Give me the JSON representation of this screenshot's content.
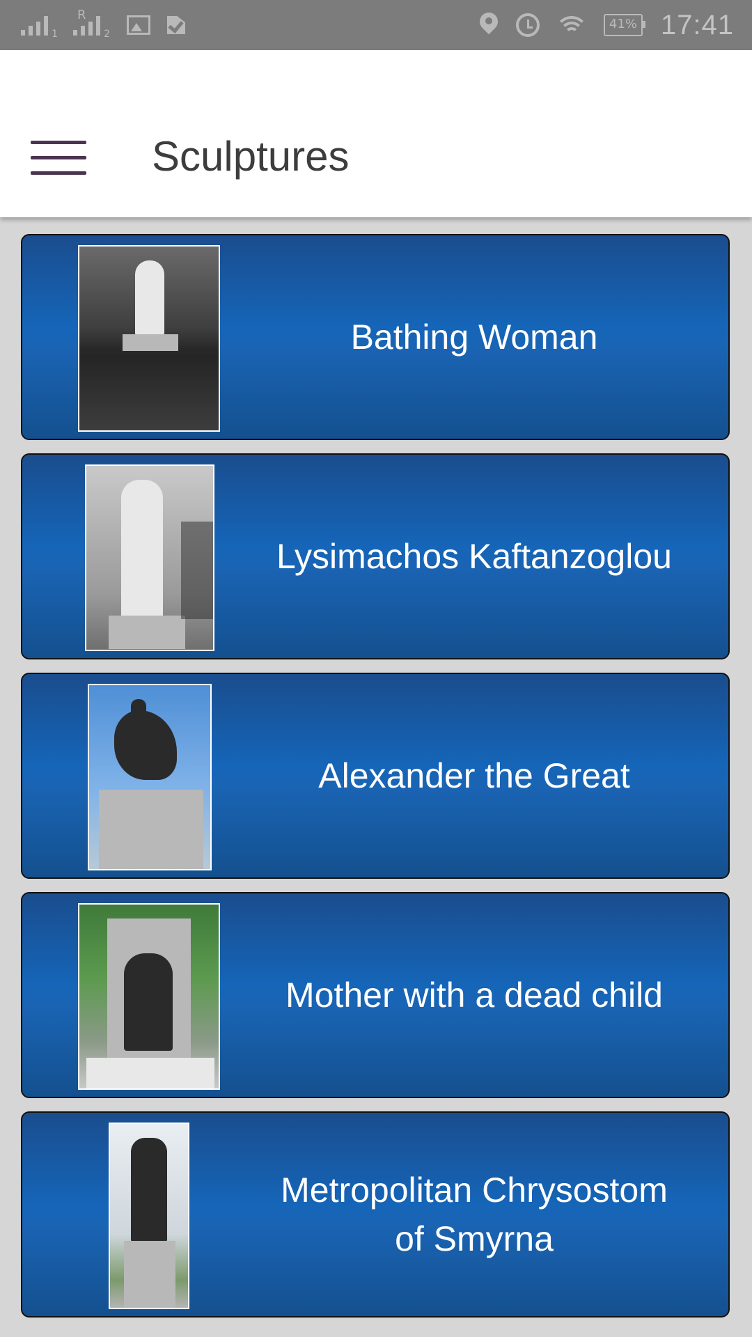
{
  "status_bar": {
    "sim1_label": "1",
    "sim2_label": "2",
    "sim2_r": "R",
    "battery": "41%",
    "time": "17:41"
  },
  "app_bar": {
    "title": "Sculptures"
  },
  "sculptures": [
    {
      "name": "Bathing Woman"
    },
    {
      "name": "Lysimachos Kaftanzoglou"
    },
    {
      "name": "Alexander the Great"
    },
    {
      "name": "Mother with a dead child"
    },
    {
      "name": "Metropolitan Chrysostom of Smyrna"
    }
  ],
  "colors": {
    "card_gradient_top": "#1a4d8e",
    "card_gradient_mid": "#1565b8",
    "status_bar": "#7c7c7c",
    "background": "#d6d6d6"
  }
}
